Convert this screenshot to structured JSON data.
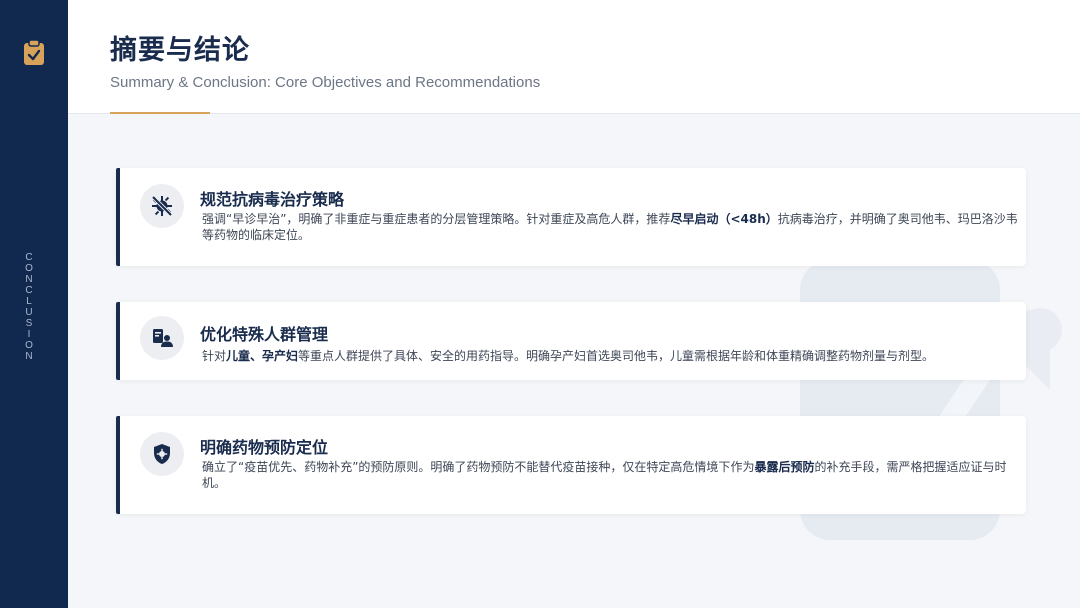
{
  "sidebar": {
    "logo_icon": "clipboard-check-icon",
    "vertical_text": "CONCLUSION"
  },
  "header": {
    "title": "摘要与结论",
    "subtitle": "Summary & Conclusion: Core Objectives and Recommendations"
  },
  "colors": {
    "navy": "#12294f",
    "accent_gold": "#d7a35a",
    "background": "#f4f6f9"
  },
  "cards": [
    {
      "icon": "virus-slash-icon",
      "title": "规范抗病毒治疗策略",
      "body": [
        {
          "text": "强调“早诊早治”，明确了非重症与重症患者的分层管理策略。针对重症及高危人群，推荐",
          "bold": false
        },
        {
          "text": "尽早启动（<48h）",
          "bold": true
        },
        {
          "text": "抗病毒治疗，并明确了奥司他韦、玛巴洛沙韦等药物的临床定位。",
          "bold": false
        }
      ]
    },
    {
      "icon": "people-id-icon",
      "title": "优化特殊人群管理",
      "body": [
        {
          "text": "针对",
          "bold": false
        },
        {
          "text": "儿童、孕产妇",
          "bold": true
        },
        {
          "text": "等重点人群提供了具体、安全的用药指导。明确孕产妇首选奥司他韦，儿童需根据年龄和体重精确调整药物剂量与剂型。",
          "bold": false
        }
      ]
    },
    {
      "icon": "shield-virus-icon",
      "title": "明确药物预防定位",
      "body": [
        {
          "text": "确立了“疫苗优先、药物补充”的预防原则。明确了药物预防不能替代疫苗接种，仅在特定高危情境下作为",
          "bold": false
        },
        {
          "text": "暴露后预防",
          "bold": true
        },
        {
          "text": "的补充手段，需严格把握适应证与时机。",
          "bold": false
        }
      ]
    }
  ]
}
